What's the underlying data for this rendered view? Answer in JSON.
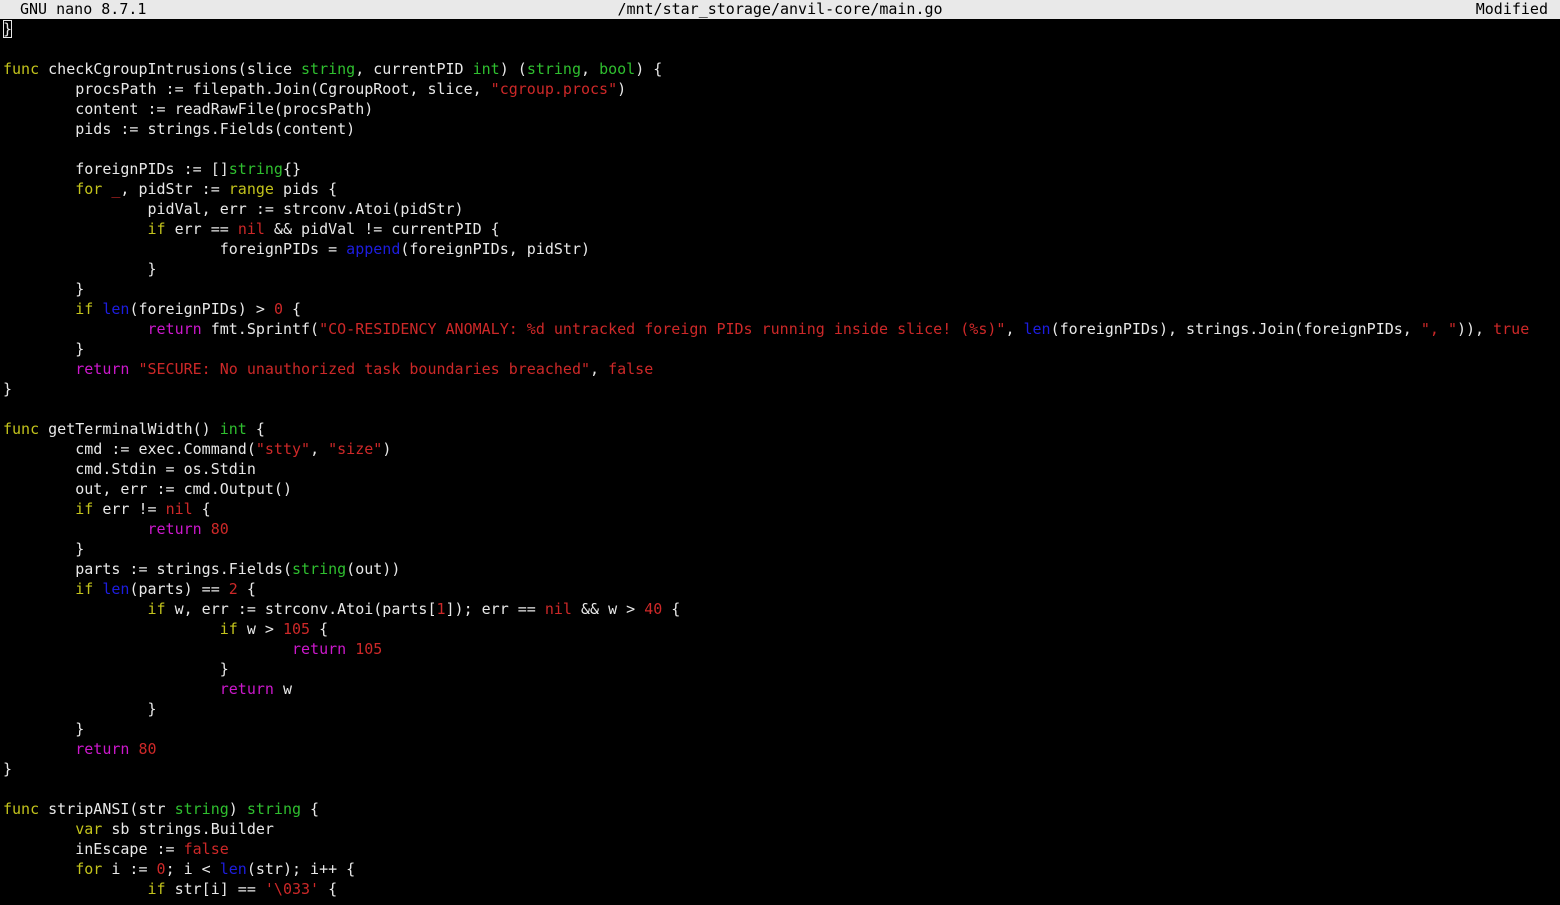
{
  "titlebar": {
    "app": "GNU nano 8.7.1",
    "path": "/mnt/star_storage/anvil-core/main.go",
    "status": "Modified"
  },
  "colors": {
    "keyword": "#c3c31c",
    "type": "#2fbf2f",
    "builtin_fn": "#1d1de0",
    "literal": "#cd2828",
    "flow": "#cc18cc",
    "text": "#e8e8e8",
    "background": "#000000",
    "titlebar_bg": "#e9e9e9"
  },
  "lines": [
    [
      [
        "}",
        "pl"
      ]
    ],
    [],
    [
      [
        "func",
        "kw"
      ],
      [
        " checkCgroupIntrusions(slice ",
        "pl"
      ],
      [
        "string",
        "ty"
      ],
      [
        ", currentPID ",
        "pl"
      ],
      [
        "int",
        "ty"
      ],
      [
        ") (",
        "pl"
      ],
      [
        "string",
        "ty"
      ],
      [
        ", ",
        "pl"
      ],
      [
        "bool",
        "ty"
      ],
      [
        ") {",
        "pl"
      ]
    ],
    [
      [
        "        procsPath := filepath.Join(CgroupRoot, slice, ",
        "pl"
      ],
      [
        "\"cgroup.procs\"",
        "st"
      ],
      [
        ")",
        "pl"
      ]
    ],
    [
      [
        "        content := readRawFile(procsPath)",
        "pl"
      ]
    ],
    [
      [
        "        pids := strings.Fields(content)",
        "pl"
      ]
    ],
    [],
    [
      [
        "        foreignPIDs := []",
        "pl"
      ],
      [
        "string",
        "ty"
      ],
      [
        "{}",
        "pl"
      ]
    ],
    [
      [
        "        ",
        "pl"
      ],
      [
        "for",
        "kw"
      ],
      [
        " ",
        "pl"
      ],
      [
        "_",
        "nu"
      ],
      [
        ", pidStr := ",
        "pl"
      ],
      [
        "range",
        "kw"
      ],
      [
        " pids {",
        "pl"
      ]
    ],
    [
      [
        "                pidVal, err := strconv.Atoi(pidStr)",
        "pl"
      ]
    ],
    [
      [
        "                ",
        "pl"
      ],
      [
        "if",
        "kw"
      ],
      [
        " err == ",
        "pl"
      ],
      [
        "nil",
        "st"
      ],
      [
        " && pidVal != currentPID {",
        "pl"
      ]
    ],
    [
      [
        "                        foreignPIDs = ",
        "pl"
      ],
      [
        "append",
        "fn"
      ],
      [
        "(foreignPIDs, pidStr)",
        "pl"
      ]
    ],
    [
      [
        "                }",
        "pl"
      ]
    ],
    [
      [
        "        }",
        "pl"
      ]
    ],
    [
      [
        "        ",
        "pl"
      ],
      [
        "if",
        "kw"
      ],
      [
        " ",
        "pl"
      ],
      [
        "len",
        "fn"
      ],
      [
        "(foreignPIDs) > ",
        "pl"
      ],
      [
        "0",
        "nu"
      ],
      [
        " {",
        "pl"
      ]
    ],
    [
      [
        "                ",
        "pl"
      ],
      [
        "return",
        "mg"
      ],
      [
        " fmt.Sprintf(",
        "pl"
      ],
      [
        "\"CO-RESIDENCY ANOMALY: %d untracked foreign PIDs running inside slice! (%s)\"",
        "st"
      ],
      [
        ", ",
        "pl"
      ],
      [
        "len",
        "fn"
      ],
      [
        "(foreignPIDs), strings.Join(foreignPIDs, ",
        "pl"
      ],
      [
        "\", \"",
        "st"
      ],
      [
        ")), ",
        "pl"
      ],
      [
        "true",
        "st"
      ]
    ],
    [
      [
        "        }",
        "pl"
      ]
    ],
    [
      [
        "        ",
        "pl"
      ],
      [
        "return",
        "mg"
      ],
      [
        " ",
        "pl"
      ],
      [
        "\"SECURE: No unauthorized task boundaries breached\"",
        "st"
      ],
      [
        ", ",
        "pl"
      ],
      [
        "false",
        "st"
      ]
    ],
    [
      [
        "}",
        "pl"
      ]
    ],
    [],
    [
      [
        "func",
        "kw"
      ],
      [
        " getTerminalWidth() ",
        "pl"
      ],
      [
        "int",
        "ty"
      ],
      [
        " {",
        "pl"
      ]
    ],
    [
      [
        "        cmd := exec.Command(",
        "pl"
      ],
      [
        "\"stty\"",
        "st"
      ],
      [
        ", ",
        "pl"
      ],
      [
        "\"size\"",
        "st"
      ],
      [
        ")",
        "pl"
      ]
    ],
    [
      [
        "        cmd.Stdin = os.Stdin",
        "pl"
      ]
    ],
    [
      [
        "        out, err := cmd.Output()",
        "pl"
      ]
    ],
    [
      [
        "        ",
        "pl"
      ],
      [
        "if",
        "kw"
      ],
      [
        " err != ",
        "pl"
      ],
      [
        "nil",
        "st"
      ],
      [
        " {",
        "pl"
      ]
    ],
    [
      [
        "                ",
        "pl"
      ],
      [
        "return",
        "mg"
      ],
      [
        " ",
        "pl"
      ],
      [
        "80",
        "nu"
      ]
    ],
    [
      [
        "        }",
        "pl"
      ]
    ],
    [
      [
        "        parts := strings.Fields(",
        "pl"
      ],
      [
        "string",
        "ty"
      ],
      [
        "(out))",
        "pl"
      ]
    ],
    [
      [
        "        ",
        "pl"
      ],
      [
        "if",
        "kw"
      ],
      [
        " ",
        "pl"
      ],
      [
        "len",
        "fn"
      ],
      [
        "(parts) == ",
        "pl"
      ],
      [
        "2",
        "nu"
      ],
      [
        " {",
        "pl"
      ]
    ],
    [
      [
        "                ",
        "pl"
      ],
      [
        "if",
        "kw"
      ],
      [
        " w, err := strconv.Atoi(parts[",
        "pl"
      ],
      [
        "1",
        "nu"
      ],
      [
        "]); err == ",
        "pl"
      ],
      [
        "nil",
        "st"
      ],
      [
        " && w > ",
        "pl"
      ],
      [
        "40",
        "nu"
      ],
      [
        " {",
        "pl"
      ]
    ],
    [
      [
        "                        ",
        "pl"
      ],
      [
        "if",
        "kw"
      ],
      [
        " w > ",
        "pl"
      ],
      [
        "105",
        "nu"
      ],
      [
        " {",
        "pl"
      ]
    ],
    [
      [
        "                                ",
        "pl"
      ],
      [
        "return",
        "mg"
      ],
      [
        " ",
        "pl"
      ],
      [
        "105",
        "nu"
      ]
    ],
    [
      [
        "                        }",
        "pl"
      ]
    ],
    [
      [
        "                        ",
        "pl"
      ],
      [
        "return",
        "mg"
      ],
      [
        " w",
        "pl"
      ]
    ],
    [
      [
        "                }",
        "pl"
      ]
    ],
    [
      [
        "        }",
        "pl"
      ]
    ],
    [
      [
        "        ",
        "pl"
      ],
      [
        "return",
        "mg"
      ],
      [
        " ",
        "pl"
      ],
      [
        "80",
        "nu"
      ]
    ],
    [
      [
        "}",
        "pl"
      ]
    ],
    [],
    [
      [
        "func",
        "kw"
      ],
      [
        " stripANSI(str ",
        "pl"
      ],
      [
        "string",
        "ty"
      ],
      [
        ") ",
        "pl"
      ],
      [
        "string",
        "ty"
      ],
      [
        " {",
        "pl"
      ]
    ],
    [
      [
        "        ",
        "pl"
      ],
      [
        "var",
        "kw"
      ],
      [
        " sb strings.Builder",
        "pl"
      ]
    ],
    [
      [
        "        inEscape := ",
        "pl"
      ],
      [
        "false",
        "st"
      ]
    ],
    [
      [
        "        ",
        "pl"
      ],
      [
        "for",
        "kw"
      ],
      [
        " i := ",
        "pl"
      ],
      [
        "0",
        "nu"
      ],
      [
        "; i < ",
        "pl"
      ],
      [
        "len",
        "fn"
      ],
      [
        "(str); i++ {",
        "pl"
      ]
    ],
    [
      [
        "                ",
        "pl"
      ],
      [
        "if",
        "kw"
      ],
      [
        " str[i] == ",
        "pl"
      ],
      [
        "'\\033'",
        "st"
      ],
      [
        " {",
        "pl"
      ]
    ]
  ]
}
